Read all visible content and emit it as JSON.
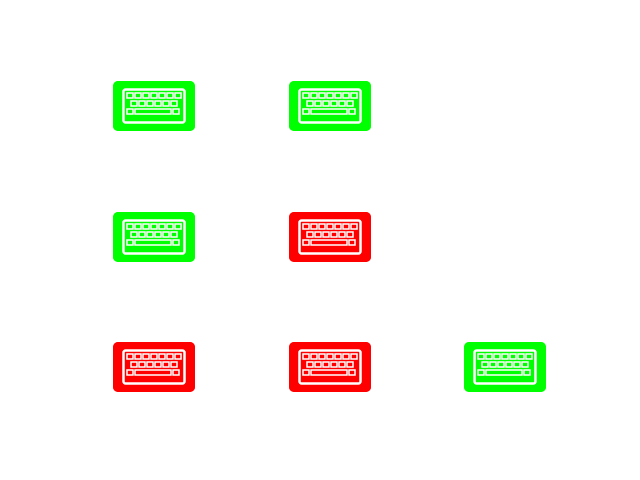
{
  "colors": {
    "on": "#00ff00",
    "off": "#ff0000",
    "key": "#ffffff"
  },
  "icon": "keyboard-icon",
  "keyboards": [
    {
      "id": "kb-r1c1",
      "state": "on"
    },
    {
      "id": "kb-r1c2",
      "state": "on"
    },
    {
      "id": "kb-r2c1",
      "state": "on"
    },
    {
      "id": "kb-r2c2",
      "state": "off"
    },
    {
      "id": "kb-r3c1",
      "state": "off"
    },
    {
      "id": "kb-r3c2",
      "state": "off"
    },
    {
      "id": "kb-r3c3",
      "state": "on"
    }
  ]
}
